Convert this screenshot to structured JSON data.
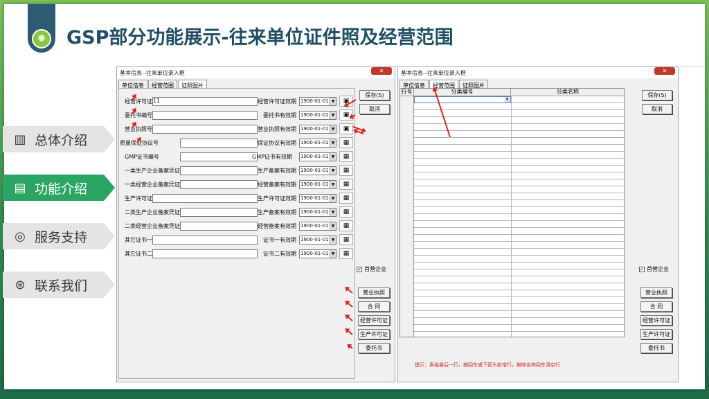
{
  "slide": {
    "title": "GSP部分功能展示-往来单位证件照及经营范围",
    "flag_icon": "lightbulb-icon"
  },
  "nav": [
    {
      "label": "总体介绍",
      "icon": "bar-chart-icon",
      "active": false
    },
    {
      "label": "功能介绍",
      "icon": "document-icon",
      "active": true
    },
    {
      "label": "服务支持",
      "icon": "target-icon",
      "active": false
    },
    {
      "label": "联系我们",
      "icon": "dart-icon",
      "active": false
    }
  ],
  "left_window": {
    "title": "基本信息--往来单位录入框",
    "close": "✕",
    "tabs": [
      "单位信息",
      "经营范围",
      "证照图片"
    ],
    "rows": [
      {
        "label": "经营许可证",
        "value": "11",
        "date_label": "经营许可证效期",
        "date": "1900-01-01"
      },
      {
        "label": "委托书编号",
        "value": "",
        "date_label": "委托书有效期",
        "date": "1900-01-01"
      },
      {
        "label": "营业执照号",
        "value": "",
        "date_label": "营业执照有效期",
        "date": "1900-01-01"
      },
      {
        "label": "质量保证协议号",
        "value": "",
        "date_label": "保证协议有效期",
        "date": "1900-01-01"
      },
      {
        "label": "GMP证书编号",
        "value": "",
        "date_label": "GMP证书有效期",
        "date": "1900-01-01"
      },
      {
        "label": "一类生产企业备案凭证",
        "value": "",
        "date_label": "生产备案有效期",
        "date": "1900-01-01"
      },
      {
        "label": "一类经营企业备案凭证",
        "value": "",
        "date_label": "经营备案有效期",
        "date": "1900-01-01"
      },
      {
        "label": "生产许可证",
        "value": "",
        "date_label": "生产许可证效期",
        "date": "1900-01-01"
      },
      {
        "label": "二类生产企业备案凭证",
        "value": "",
        "date_label": "生产备案有效期",
        "date": "1900-01-01"
      },
      {
        "label": "二类经营企业备案凭证",
        "value": "",
        "date_label": "经营备案有效期",
        "date": "1900-01-01"
      },
      {
        "label": "其它证书一",
        "value": "",
        "date_label": "证书一有效期",
        "date": "1900-01-01"
      },
      {
        "label": "其它证书二",
        "value": "",
        "date_label": "证书二有效期",
        "date": "1900-01-01"
      }
    ],
    "save": "保存(S)",
    "cancel": "取消",
    "checkbox_label": "首营企业",
    "checked": "✓",
    "doc_buttons": [
      "营业执照",
      "合 同",
      "经营许可证",
      "生产许可证",
      "委托书"
    ]
  },
  "right_window": {
    "title": "基本信息--往来单位录入框",
    "close": "✕",
    "tabs": [
      "单位信息",
      "经营范围",
      "证照图片"
    ],
    "columns": [
      "行号",
      "分类编号",
      "分类名称"
    ],
    "save": "保存(S)",
    "cancel": "取消",
    "checkbox_label": "首营企业",
    "checked": "✓",
    "doc_buttons": [
      "营业执照",
      "合 同",
      "经营许可证",
      "生产许可证",
      "委托书"
    ],
    "hint": "提示：表格最后一行，按回车或下箭头新增行，删除名称回车清空行"
  }
}
